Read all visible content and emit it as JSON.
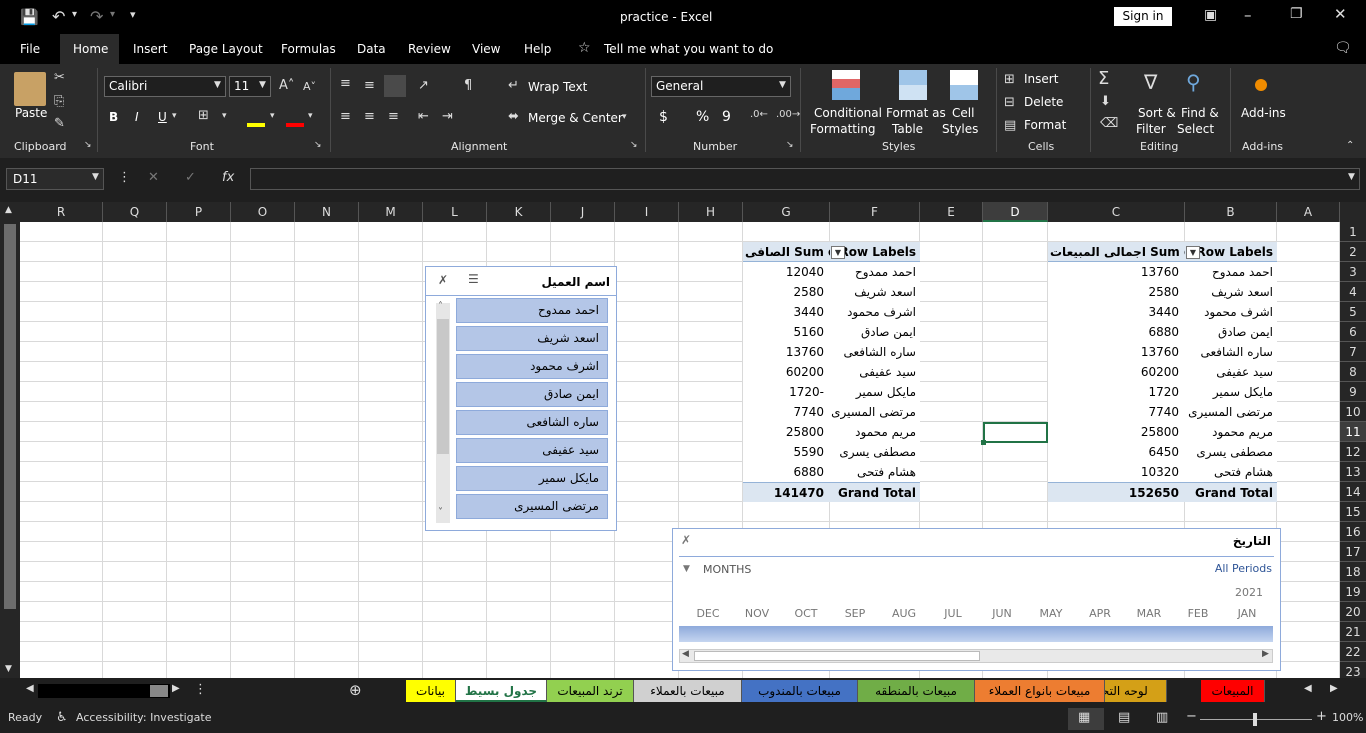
{
  "title": {
    "doc": "practice",
    "sep": "-",
    "app": "Excel",
    "signin": "Sign in"
  },
  "menu": [
    "File",
    "Home",
    "Insert",
    "Page Layout",
    "Formulas",
    "Data",
    "Review",
    "View",
    "Help"
  ],
  "tell_me": "Tell me what you want to do",
  "ribbon": {
    "paste": "Paste",
    "clipboard": "Clipboard",
    "font_name": "Calibri",
    "font_size": "11",
    "font": "Font",
    "wrap": "Wrap Text",
    "merge": "Merge & Center",
    "alignment": "Alignment",
    "number_format": "General",
    "number": "Number",
    "cond1": "Conditional",
    "cond2": "Formatting",
    "fmt1": "Format as",
    "fmt2": "Table",
    "cell1": "Cell",
    "cell2": "Styles",
    "styles": "Styles",
    "insert": "Insert",
    "delete": "Delete",
    "format": "Format",
    "cells": "Cells",
    "sort1": "Sort &",
    "sort2": "Filter",
    "find1": "Find &",
    "find2": "Select",
    "editing": "Editing",
    "addins": "Add-ins",
    "addins_group": "Add-ins",
    "bold": "B",
    "italic": "I",
    "underline": "U",
    "currency": "$",
    "percent": "%",
    "comma": "9"
  },
  "name_box": "D11",
  "fx": "fx",
  "columns": [
    "R",
    "Q",
    "P",
    "O",
    "N",
    "M",
    "L",
    "K",
    "J",
    "I",
    "H",
    "G",
    "F",
    "E",
    "D",
    "C",
    "B",
    "A"
  ],
  "rows": [
    "1",
    "2",
    "3",
    "4",
    "5",
    "6",
    "7",
    "8",
    "9",
    "10",
    "11",
    "12",
    "13",
    "14",
    "15",
    "16",
    "17",
    "18",
    "19",
    "20",
    "21",
    "22",
    "23"
  ],
  "pivot1": {
    "row_labels": "Row Labels",
    "value_header": "اجمالى المبيعات Sum of",
    "rows": [
      {
        "name": "احمد ممدوح",
        "value": "13760"
      },
      {
        "name": "اسعد شريف",
        "value": "2580"
      },
      {
        "name": "اشرف محمود",
        "value": "3440"
      },
      {
        "name": "ايمن صادق",
        "value": "6880"
      },
      {
        "name": "ساره الشافعى",
        "value": "13760"
      },
      {
        "name": "سيد عفيفى",
        "value": "60200"
      },
      {
        "name": "مايكل سمير",
        "value": "1720"
      },
      {
        "name": "مرتضى المسيرى",
        "value": "7740"
      },
      {
        "name": "مريم محمود",
        "value": "25800"
      },
      {
        "name": "مصطفى يسرى",
        "value": "6450"
      },
      {
        "name": "هشام فتحى",
        "value": "10320"
      }
    ],
    "total_label": "Grand Total",
    "total": "152650"
  },
  "pivot2": {
    "row_labels": "Row Labels",
    "value_header": "الصافى Sum of",
    "rows": [
      {
        "name": "احمد ممدوح",
        "value": "12040"
      },
      {
        "name": "اسعد شريف",
        "value": "2580"
      },
      {
        "name": "اشرف محمود",
        "value": "3440"
      },
      {
        "name": "ايمن صادق",
        "value": "5160"
      },
      {
        "name": "ساره الشافعى",
        "value": "13760"
      },
      {
        "name": "سيد عفيفى",
        "value": "60200"
      },
      {
        "name": "مايكل سمير",
        "value": "1720-"
      },
      {
        "name": "مرتضى المسيرى",
        "value": "7740"
      },
      {
        "name": "مريم محمود",
        "value": "25800"
      },
      {
        "name": "مصطفى يسرى",
        "value": "5590"
      },
      {
        "name": "هشام فتحى",
        "value": "6880"
      }
    ],
    "total_label": "Grand Total",
    "total": "141470"
  },
  "slicer": {
    "title": "اسم العميل",
    "items": [
      "احمد ممدوح",
      "اسعد شريف",
      "اشرف محمود",
      "ايمن صادق",
      "ساره الشافعى",
      "سيد عفيفى",
      "مايكل سمير",
      "مرتضى المسيرى"
    ]
  },
  "timeline": {
    "title": "التاريخ",
    "all_periods": "All Periods",
    "level": "MONTHS",
    "year": "2021",
    "months": [
      "JAN",
      "FEB",
      "MAR",
      "APR",
      "MAY",
      "JUN",
      "JUL",
      "AUG",
      "SEP",
      "OCT",
      "NOV",
      "DEC"
    ]
  },
  "sheets": [
    {
      "name": "المبيعات",
      "color": "#ff0000"
    },
    {
      "name": "لوحه التحكم",
      "color": "#d4a017"
    },
    {
      "name": "مبيعات بانواع العملاء",
      "color": "#ed7d31"
    },
    {
      "name": "مبيعات بالمنطقه",
      "color": "#70ad47"
    },
    {
      "name": "مبيعات بالمندوب",
      "color": "#4472c4"
    },
    {
      "name": "مبيعات بالعملاء",
      "color": "#d0d0d0"
    },
    {
      "name": "ترند المبيعات",
      "color": "#92d050"
    },
    {
      "name": "جدول بسيط",
      "color": "#ffffff"
    },
    {
      "name": "بيانات",
      "color": "#ffff00"
    }
  ],
  "status": {
    "ready": "Ready",
    "accessibility": "Accessibility: Investigate",
    "zoom": "100%"
  }
}
